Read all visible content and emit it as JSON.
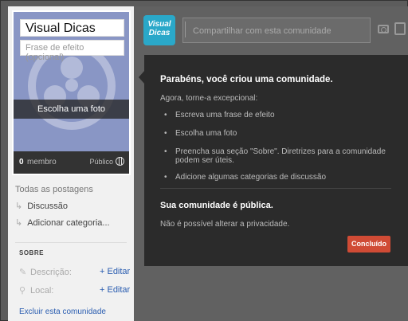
{
  "community": {
    "name": "Visual Dicas",
    "tagline_placeholder": "Frase de efeito (opcional)",
    "photo_label": "Escolha uma foto",
    "member_count": "0",
    "member_label": "membro",
    "privacy": "Público"
  },
  "sidebar": {
    "all_posts": "Todas as postagens",
    "categories": [
      {
        "label": "Discussão"
      },
      {
        "label": "Adicionar categoria..."
      }
    ],
    "about_heading": "SOBRE",
    "description_label": "Descrição:",
    "location_label": "Local:",
    "edit_label": "+ Editar",
    "delete_label": "Excluir esta comunidade"
  },
  "header": {
    "badge_text": "Visual Dicas",
    "share_placeholder": "Compartilhar com esta comunidade"
  },
  "dialog": {
    "title": "Parabéns, você criou uma comunidade.",
    "subtitle": "Agora, torne-a excepcional:",
    "items": [
      "Escreva uma frase de efeito",
      "Escolha uma foto",
      "Preencha sua seção \"Sobre\". Diretrizes para a comunidade podem ser úteis.",
      "Adicione algumas categorias de discussão"
    ],
    "public_title": "Sua comunidade é pública.",
    "public_note": "Não é possível alterar a privacidade.",
    "done_label": "Concluído"
  },
  "colors": {
    "accent_button": "#d04b35",
    "link": "#2a5db0",
    "badge": "#2aa8c9",
    "cover": "#8996c5"
  }
}
